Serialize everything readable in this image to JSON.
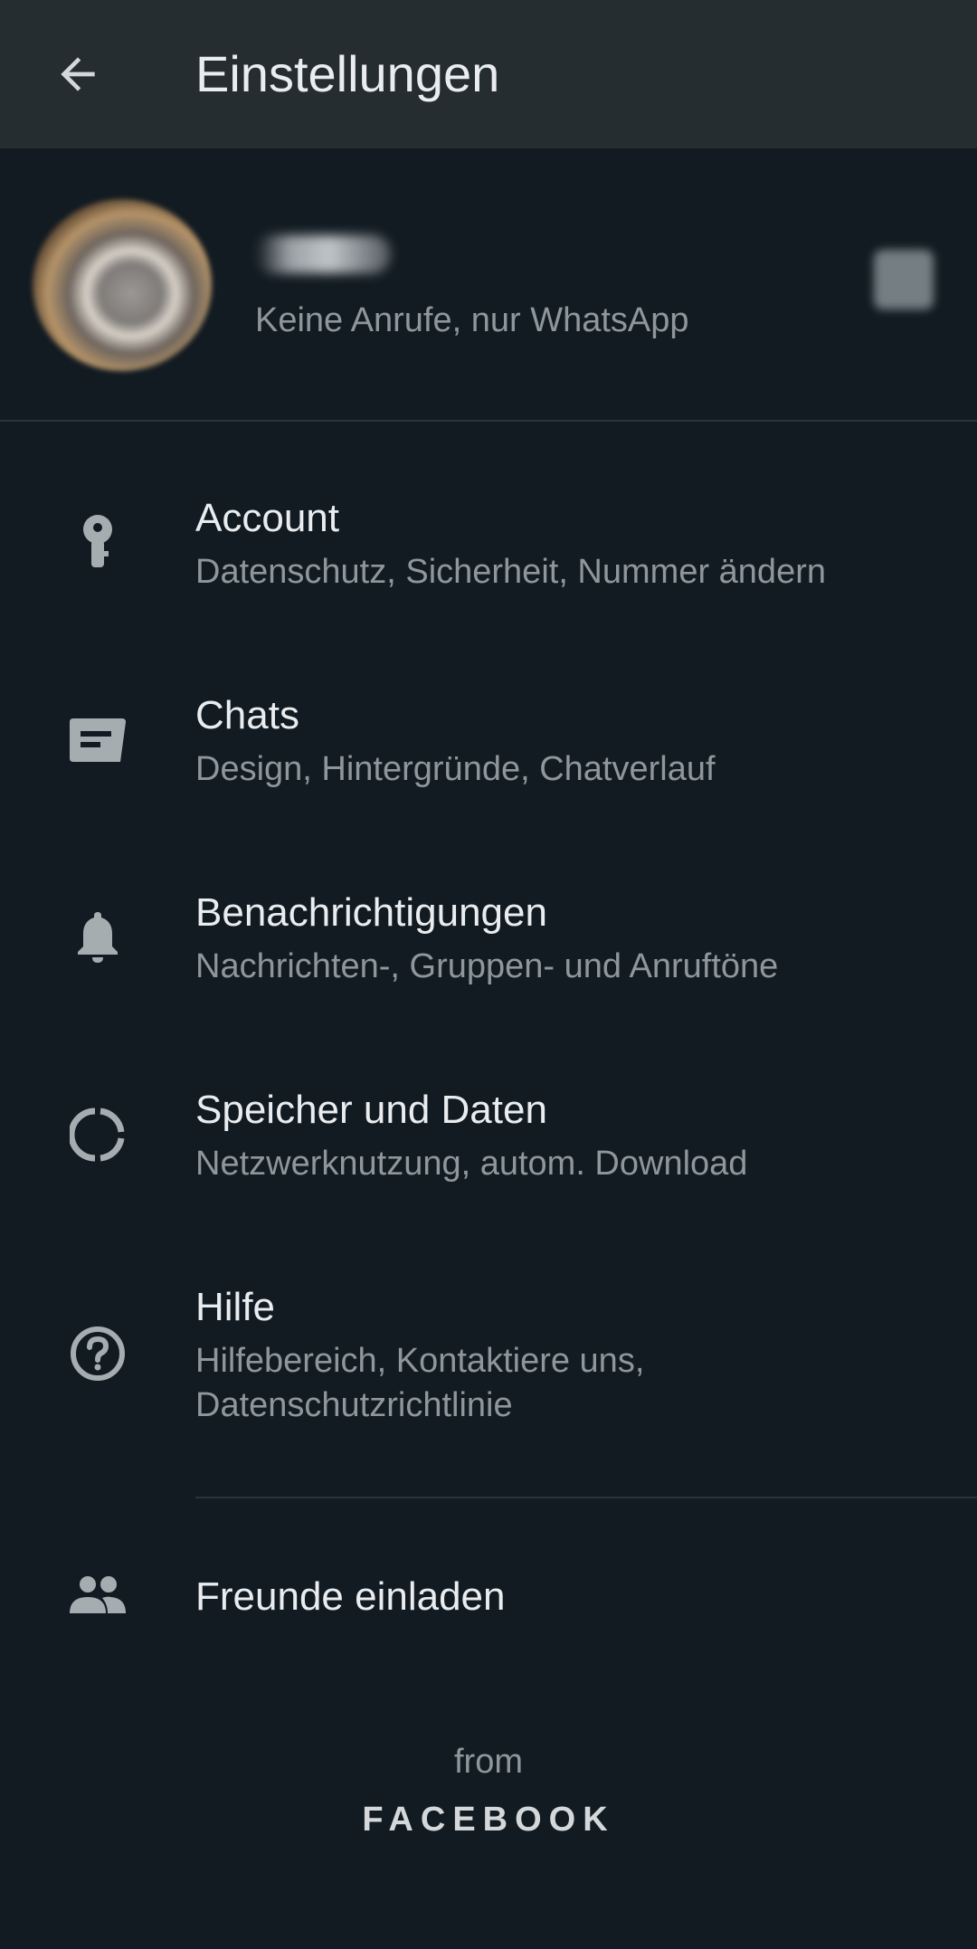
{
  "appbar": {
    "title": "Einstellungen",
    "back_icon": "arrow-left-icon"
  },
  "profile": {
    "status": "Keine Anrufe, nur WhatsApp"
  },
  "menu": [
    {
      "icon": "key-icon",
      "title": "Account",
      "subtitle": "Datenschutz, Sicherheit, Nummer ändern"
    },
    {
      "icon": "chat-icon",
      "title": "Chats",
      "subtitle": "Design, Hintergründe, Chatverlauf"
    },
    {
      "icon": "bell-icon",
      "title": "Benachrichtigungen",
      "subtitle": "Nachrichten-, Gruppen- und Anruftöne"
    },
    {
      "icon": "storage-ring-icon",
      "title": "Speicher und Daten",
      "subtitle": "Netzwerknutzung, autom. Download"
    },
    {
      "icon": "help-circle-icon",
      "title": "Hilfe",
      "subtitle": "Hilfebereich, Kontaktiere uns,",
      "subtitle_line2": "Datenschutzrichtlinie"
    },
    {
      "icon": "people-icon",
      "title": "Freunde einladen"
    }
  ],
  "footer": {
    "from": "from",
    "brand": "FACEBOOK"
  },
  "colors": {
    "background": "#121b22",
    "appbar": "#262d31",
    "text_primary": "#e9edef",
    "text_secondary": "#8f979c",
    "icon": "#a5adb1"
  }
}
